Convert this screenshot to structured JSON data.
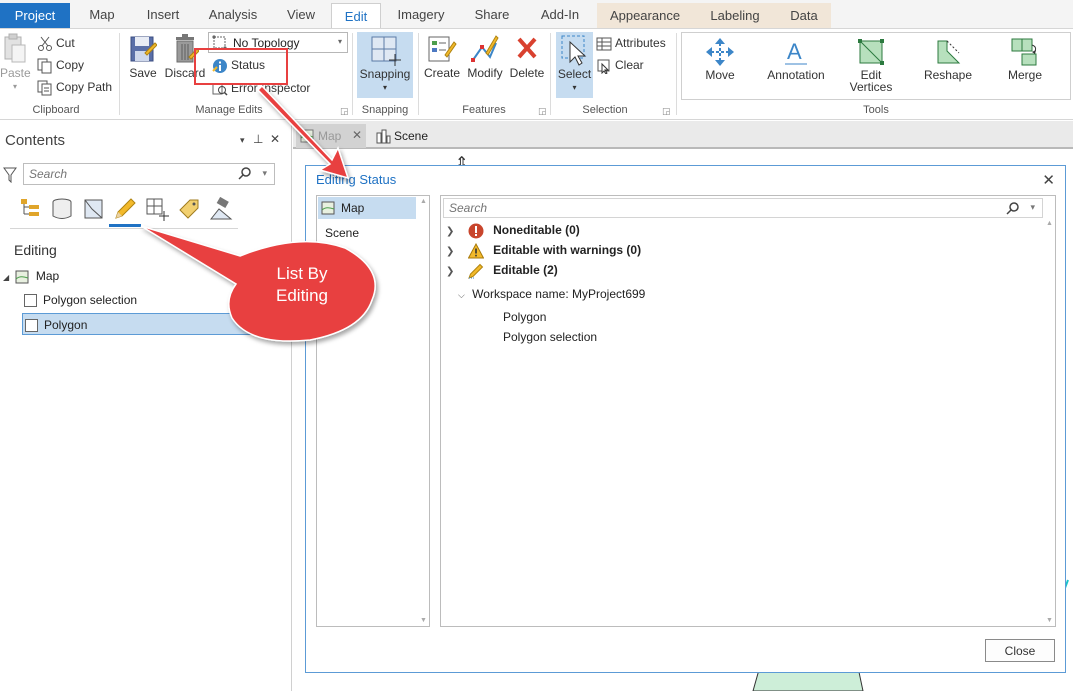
{
  "ribbon": {
    "tabs": [
      "Project",
      "Map",
      "Insert",
      "Analysis",
      "View",
      "Edit",
      "Imagery",
      "Share",
      "Add-In",
      "Appearance",
      "Labeling",
      "Data"
    ],
    "active_tab": "Edit",
    "clipboard": {
      "paste": "Paste",
      "cut": "Cut",
      "copy": "Copy",
      "copy_path": "Copy Path",
      "group": "Clipboard"
    },
    "manage_edits": {
      "save": "Save",
      "discard": "Discard",
      "topology": "No Topology",
      "status": "Status",
      "error_inspector": "Error Inspector",
      "group": "Manage Edits"
    },
    "snapping": {
      "button": "Snapping",
      "group": "Snapping"
    },
    "features": {
      "create": "Create",
      "modify": "Modify",
      "delete": "Delete",
      "group": "Features"
    },
    "selection": {
      "select": "Select",
      "attributes": "Attributes",
      "clear": "Clear",
      "group": "Selection"
    },
    "tools": {
      "move": "Move",
      "annotation": "Annotation",
      "edit_vertices_1": "Edit",
      "edit_vertices_2": "Vertices",
      "reshape": "Reshape",
      "merge": "Merge",
      "group": "Tools"
    }
  },
  "contents": {
    "title": "Contents",
    "search_placeholder": "Search",
    "section": "Editing",
    "map": "Map",
    "layers": [
      "Polygon selection",
      "Polygon"
    ]
  },
  "view_tabs": {
    "map": "Map",
    "scene": "Scene"
  },
  "dialog": {
    "title": "Editing Status",
    "list": [
      "Map",
      "Scene"
    ],
    "search_placeholder": "Search",
    "noneditable": "Noneditable (0)",
    "warnings": "Editable with warnings (0)",
    "editable": "Editable (2)",
    "workspace": "Workspace name: MyProject699",
    "layers": [
      "Polygon",
      "Polygon selection"
    ],
    "close_button": "Close"
  },
  "callout": {
    "text_1": "List By",
    "text_2": "Editing"
  },
  "colors": {
    "accent": "#1f72c4",
    "callout": "#e84040",
    "selected": "#c6dcf0"
  }
}
